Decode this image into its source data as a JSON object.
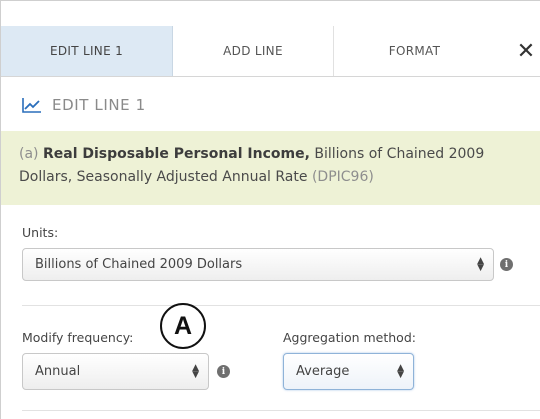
{
  "tabs": [
    {
      "label": "EDIT LINE 1",
      "active": true
    },
    {
      "label": "ADD LINE",
      "active": false
    },
    {
      "label": "FORMAT",
      "active": false
    }
  ],
  "close_label": "✕",
  "edit_header": {
    "icon": "line-chart-icon",
    "title": "EDIT LINE 1"
  },
  "series": {
    "prefix": "(a)",
    "name": "Real Disposable Personal Income,",
    "description": "Billions of Chained 2009 Dollars, Seasonally Adjusted Annual Rate",
    "code": "(DPIC96)"
  },
  "units": {
    "label": "Units:",
    "selected": "Billions of Chained 2009 Dollars"
  },
  "frequency": {
    "label": "Modify frequency:",
    "selected": "Annual"
  },
  "aggregation": {
    "label": "Aggregation method:",
    "selected": "Average"
  },
  "callout": {
    "letter": "A"
  },
  "colors": {
    "active_tab": "#dde9f4",
    "series_box": "#eef2d6",
    "series_code": "#8e8e8e",
    "link_icon": "#2a6ebb"
  }
}
